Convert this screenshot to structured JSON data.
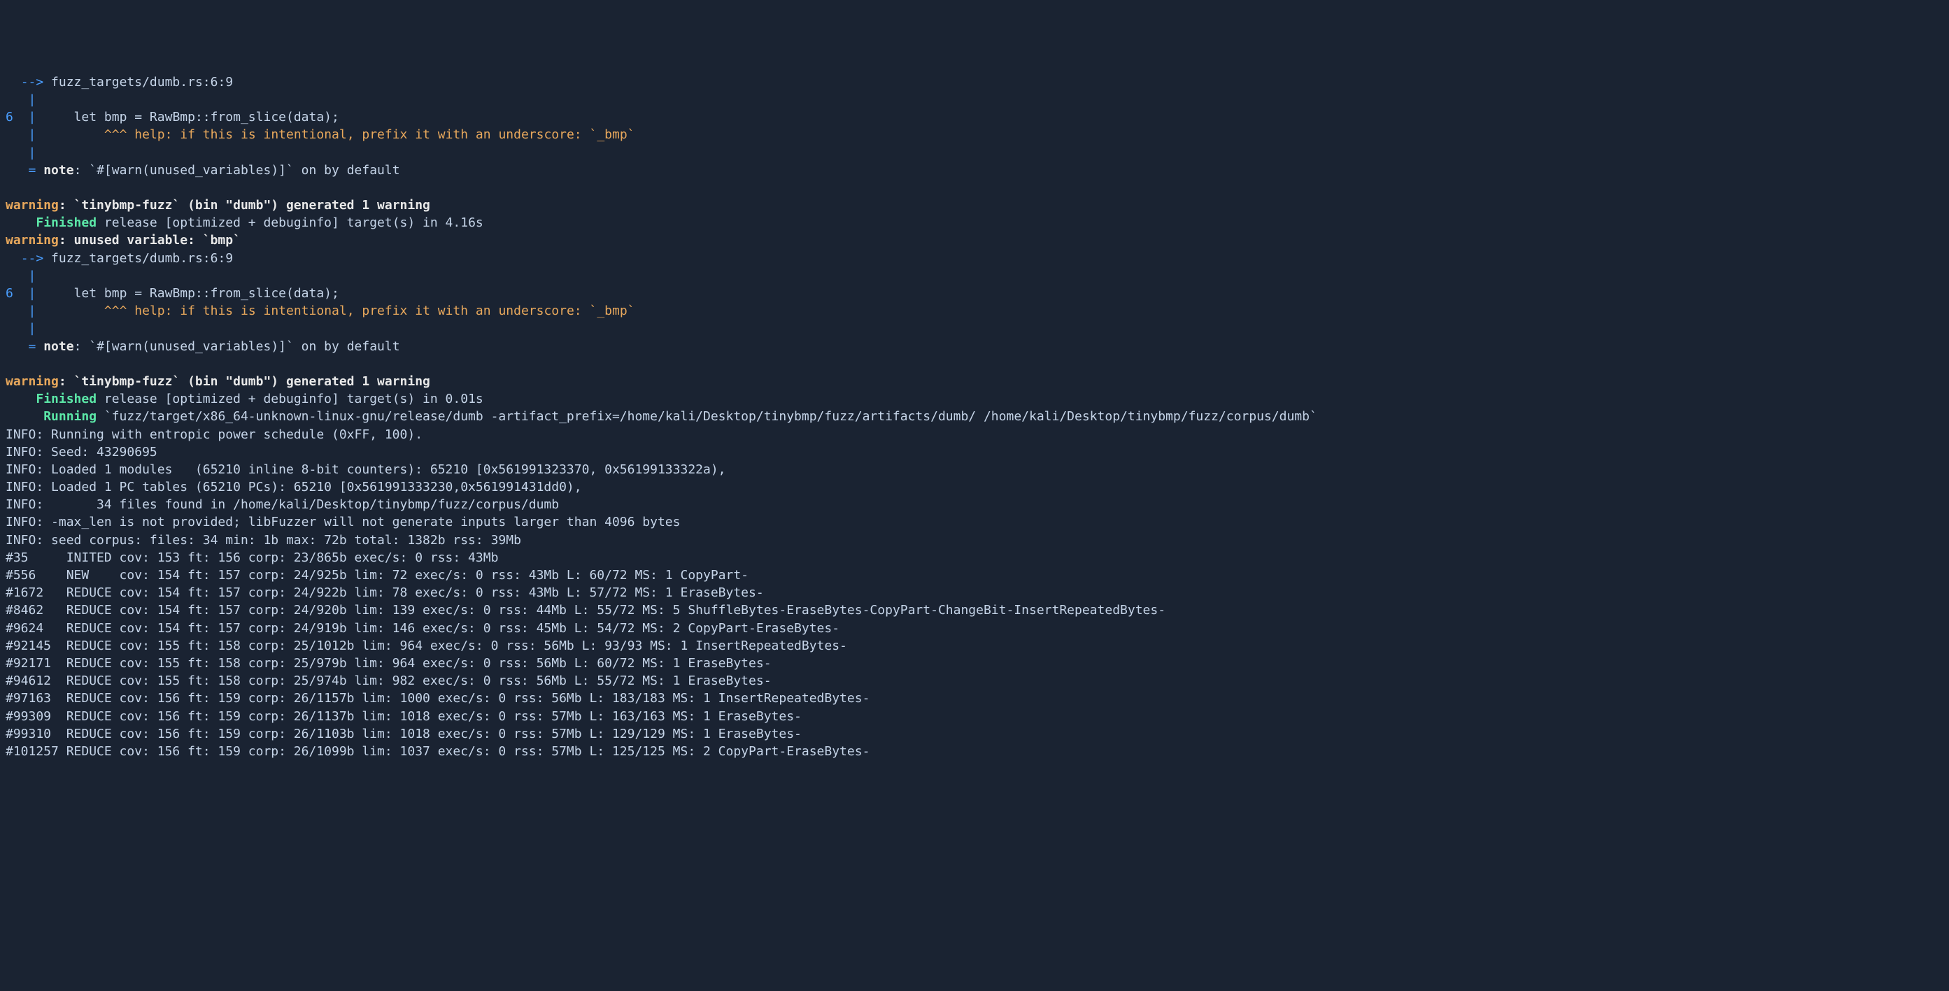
{
  "terminal": {
    "lines": [
      {
        "segments": [
          {
            "t": "  ",
            "c": ""
          },
          {
            "t": "-->",
            "c": "blue"
          },
          {
            "t": " fuzz_targets/dumb.rs:6:9",
            "c": ""
          }
        ]
      },
      {
        "segments": [
          {
            "t": "   ",
            "c": ""
          },
          {
            "t": "|",
            "c": "blue"
          },
          {
            "t": "",
            "c": ""
          }
        ]
      },
      {
        "segments": [
          {
            "t": "6",
            "c": "blue"
          },
          {
            "t": "  ",
            "c": ""
          },
          {
            "t": "|",
            "c": "blue"
          },
          {
            "t": "     let bmp = RawBmp::from_slice(data);",
            "c": ""
          }
        ]
      },
      {
        "segments": [
          {
            "t": "   ",
            "c": ""
          },
          {
            "t": "|",
            "c": "blue"
          },
          {
            "t": "         ",
            "c": ""
          },
          {
            "t": "^^^",
            "c": "orange"
          },
          {
            "t": " ",
            "c": ""
          },
          {
            "t": "help: if this is intentional, prefix it with an underscore: `_bmp`",
            "c": "orange"
          }
        ]
      },
      {
        "segments": [
          {
            "t": "   ",
            "c": ""
          },
          {
            "t": "|",
            "c": "blue"
          },
          {
            "t": "",
            "c": ""
          }
        ]
      },
      {
        "segments": [
          {
            "t": "   ",
            "c": ""
          },
          {
            "t": "=",
            "c": "blue"
          },
          {
            "t": " ",
            "c": ""
          },
          {
            "t": "note",
            "c": "white bold"
          },
          {
            "t": ": `#[warn(unused_variables)]` on by default",
            "c": ""
          }
        ]
      },
      {
        "segments": [
          {
            "t": " ",
            "c": ""
          }
        ]
      },
      {
        "segments": [
          {
            "t": "warning",
            "c": "orange bold"
          },
          {
            "t": ": `tinybmp-fuzz` (bin \"dumb\") generated 1 warning",
            "c": "white bold"
          }
        ]
      },
      {
        "segments": [
          {
            "t": "    ",
            "c": ""
          },
          {
            "t": "Finished",
            "c": "green"
          },
          {
            "t": " release [optimized + debuginfo] target(s) in 4.16s",
            "c": ""
          }
        ]
      },
      {
        "segments": [
          {
            "t": "warning",
            "c": "orange bold"
          },
          {
            "t": ": unused variable: `bmp`",
            "c": "white bold"
          }
        ]
      },
      {
        "segments": [
          {
            "t": "  ",
            "c": ""
          },
          {
            "t": "-->",
            "c": "blue"
          },
          {
            "t": " fuzz_targets/dumb.rs:6:9",
            "c": ""
          }
        ]
      },
      {
        "segments": [
          {
            "t": "   ",
            "c": ""
          },
          {
            "t": "|",
            "c": "blue"
          },
          {
            "t": "",
            "c": ""
          }
        ]
      },
      {
        "segments": [
          {
            "t": "6",
            "c": "blue"
          },
          {
            "t": "  ",
            "c": ""
          },
          {
            "t": "|",
            "c": "blue"
          },
          {
            "t": "     let bmp = RawBmp::from_slice(data);",
            "c": ""
          }
        ]
      },
      {
        "segments": [
          {
            "t": "   ",
            "c": ""
          },
          {
            "t": "|",
            "c": "blue"
          },
          {
            "t": "         ",
            "c": ""
          },
          {
            "t": "^^^",
            "c": "orange"
          },
          {
            "t": " ",
            "c": ""
          },
          {
            "t": "help: if this is intentional, prefix it with an underscore: `_bmp`",
            "c": "orange"
          }
        ]
      },
      {
        "segments": [
          {
            "t": "   ",
            "c": ""
          },
          {
            "t": "|",
            "c": "blue"
          },
          {
            "t": "",
            "c": ""
          }
        ]
      },
      {
        "segments": [
          {
            "t": "   ",
            "c": ""
          },
          {
            "t": "=",
            "c": "blue"
          },
          {
            "t": " ",
            "c": ""
          },
          {
            "t": "note",
            "c": "white bold"
          },
          {
            "t": ": `#[warn(unused_variables)]` on by default",
            "c": ""
          }
        ]
      },
      {
        "segments": [
          {
            "t": " ",
            "c": ""
          }
        ]
      },
      {
        "segments": [
          {
            "t": "warning",
            "c": "orange bold"
          },
          {
            "t": ": `tinybmp-fuzz` (bin \"dumb\") generated 1 warning",
            "c": "white bold"
          }
        ]
      },
      {
        "segments": [
          {
            "t": "    ",
            "c": ""
          },
          {
            "t": "Finished",
            "c": "green"
          },
          {
            "t": " release [optimized + debuginfo] target(s) in 0.01s",
            "c": ""
          }
        ]
      },
      {
        "segments": [
          {
            "t": "     ",
            "c": ""
          },
          {
            "t": "Running",
            "c": "green"
          },
          {
            "t": " `fuzz/target/x86_64-unknown-linux-gnu/release/dumb -artifact_prefix=/home/kali/Desktop/tinybmp/fuzz/artifacts/dumb/ /home/kali/Desktop/tinybmp/fuzz/corpus/dumb`",
            "c": ""
          }
        ]
      },
      {
        "segments": [
          {
            "t": "INFO: Running with entropic power schedule (0xFF, 100).",
            "c": ""
          }
        ]
      },
      {
        "segments": [
          {
            "t": "INFO: Seed: 43290695",
            "c": ""
          }
        ]
      },
      {
        "segments": [
          {
            "t": "INFO: Loaded 1 modules   (65210 inline 8-bit counters): 65210 [0x561991323370, 0x56199133322a),",
            "c": ""
          }
        ]
      },
      {
        "segments": [
          {
            "t": "INFO: Loaded 1 PC tables (65210 PCs): 65210 [0x561991333230,0x561991431dd0),",
            "c": ""
          }
        ]
      },
      {
        "segments": [
          {
            "t": "INFO:       34 files found in /home/kali/Desktop/tinybmp/fuzz/corpus/dumb",
            "c": ""
          }
        ]
      },
      {
        "segments": [
          {
            "t": "INFO: -max_len is not provided; libFuzzer will not generate inputs larger than 4096 bytes",
            "c": ""
          }
        ]
      },
      {
        "segments": [
          {
            "t": "INFO: seed corpus: files: 34 min: 1b max: 72b total: 1382b rss: 39Mb",
            "c": ""
          }
        ]
      },
      {
        "segments": [
          {
            "t": "#35     INITED cov: 153 ft: 156 corp: 23/865b exec/s: 0 rss: 43Mb",
            "c": ""
          }
        ]
      },
      {
        "segments": [
          {
            "t": "#556    NEW    cov: 154 ft: 157 corp: 24/925b lim: 72 exec/s: 0 rss: 43Mb L: 60/72 MS: 1 CopyPart-",
            "c": ""
          }
        ]
      },
      {
        "segments": [
          {
            "t": "#1672   REDUCE cov: 154 ft: 157 corp: 24/922b lim: 78 exec/s: 0 rss: 43Mb L: 57/72 MS: 1 EraseBytes-",
            "c": ""
          }
        ]
      },
      {
        "segments": [
          {
            "t": "#8462   REDUCE cov: 154 ft: 157 corp: 24/920b lim: 139 exec/s: 0 rss: 44Mb L: 55/72 MS: 5 ShuffleBytes-EraseBytes-CopyPart-ChangeBit-InsertRepeatedBytes-",
            "c": ""
          }
        ]
      },
      {
        "segments": [
          {
            "t": "#9624   REDUCE cov: 154 ft: 157 corp: 24/919b lim: 146 exec/s: 0 rss: 45Mb L: 54/72 MS: 2 CopyPart-EraseBytes-",
            "c": ""
          }
        ]
      },
      {
        "segments": [
          {
            "t": "#92145  REDUCE cov: 155 ft: 158 corp: 25/1012b lim: 964 exec/s: 0 rss: 56Mb L: 93/93 MS: 1 InsertRepeatedBytes-",
            "c": ""
          }
        ]
      },
      {
        "segments": [
          {
            "t": "#92171  REDUCE cov: 155 ft: 158 corp: 25/979b lim: 964 exec/s: 0 rss: 56Mb L: 60/72 MS: 1 EraseBytes-",
            "c": ""
          }
        ]
      },
      {
        "segments": [
          {
            "t": "#94612  REDUCE cov: 155 ft: 158 corp: 25/974b lim: 982 exec/s: 0 rss: 56Mb L: 55/72 MS: 1 EraseBytes-",
            "c": ""
          }
        ]
      },
      {
        "segments": [
          {
            "t": "#97163  REDUCE cov: 156 ft: 159 corp: 26/1157b lim: 1000 exec/s: 0 rss: 56Mb L: 183/183 MS: 1 InsertRepeatedBytes-",
            "c": ""
          }
        ]
      },
      {
        "segments": [
          {
            "t": "#99309  REDUCE cov: 156 ft: 159 corp: 26/1137b lim: 1018 exec/s: 0 rss: 57Mb L: 163/163 MS: 1 EraseBytes-",
            "c": ""
          }
        ]
      },
      {
        "segments": [
          {
            "t": "#99310  REDUCE cov: 156 ft: 159 corp: 26/1103b lim: 1018 exec/s: 0 rss: 57Mb L: 129/129 MS: 1 EraseBytes-",
            "c": ""
          }
        ]
      },
      {
        "segments": [
          {
            "t": "#101257 REDUCE cov: 156 ft: 159 corp: 26/1099b lim: 1037 exec/s: 0 rss: 57Mb L: 125/125 MS: 2 CopyPart-EraseBytes-",
            "c": ""
          }
        ]
      }
    ]
  }
}
